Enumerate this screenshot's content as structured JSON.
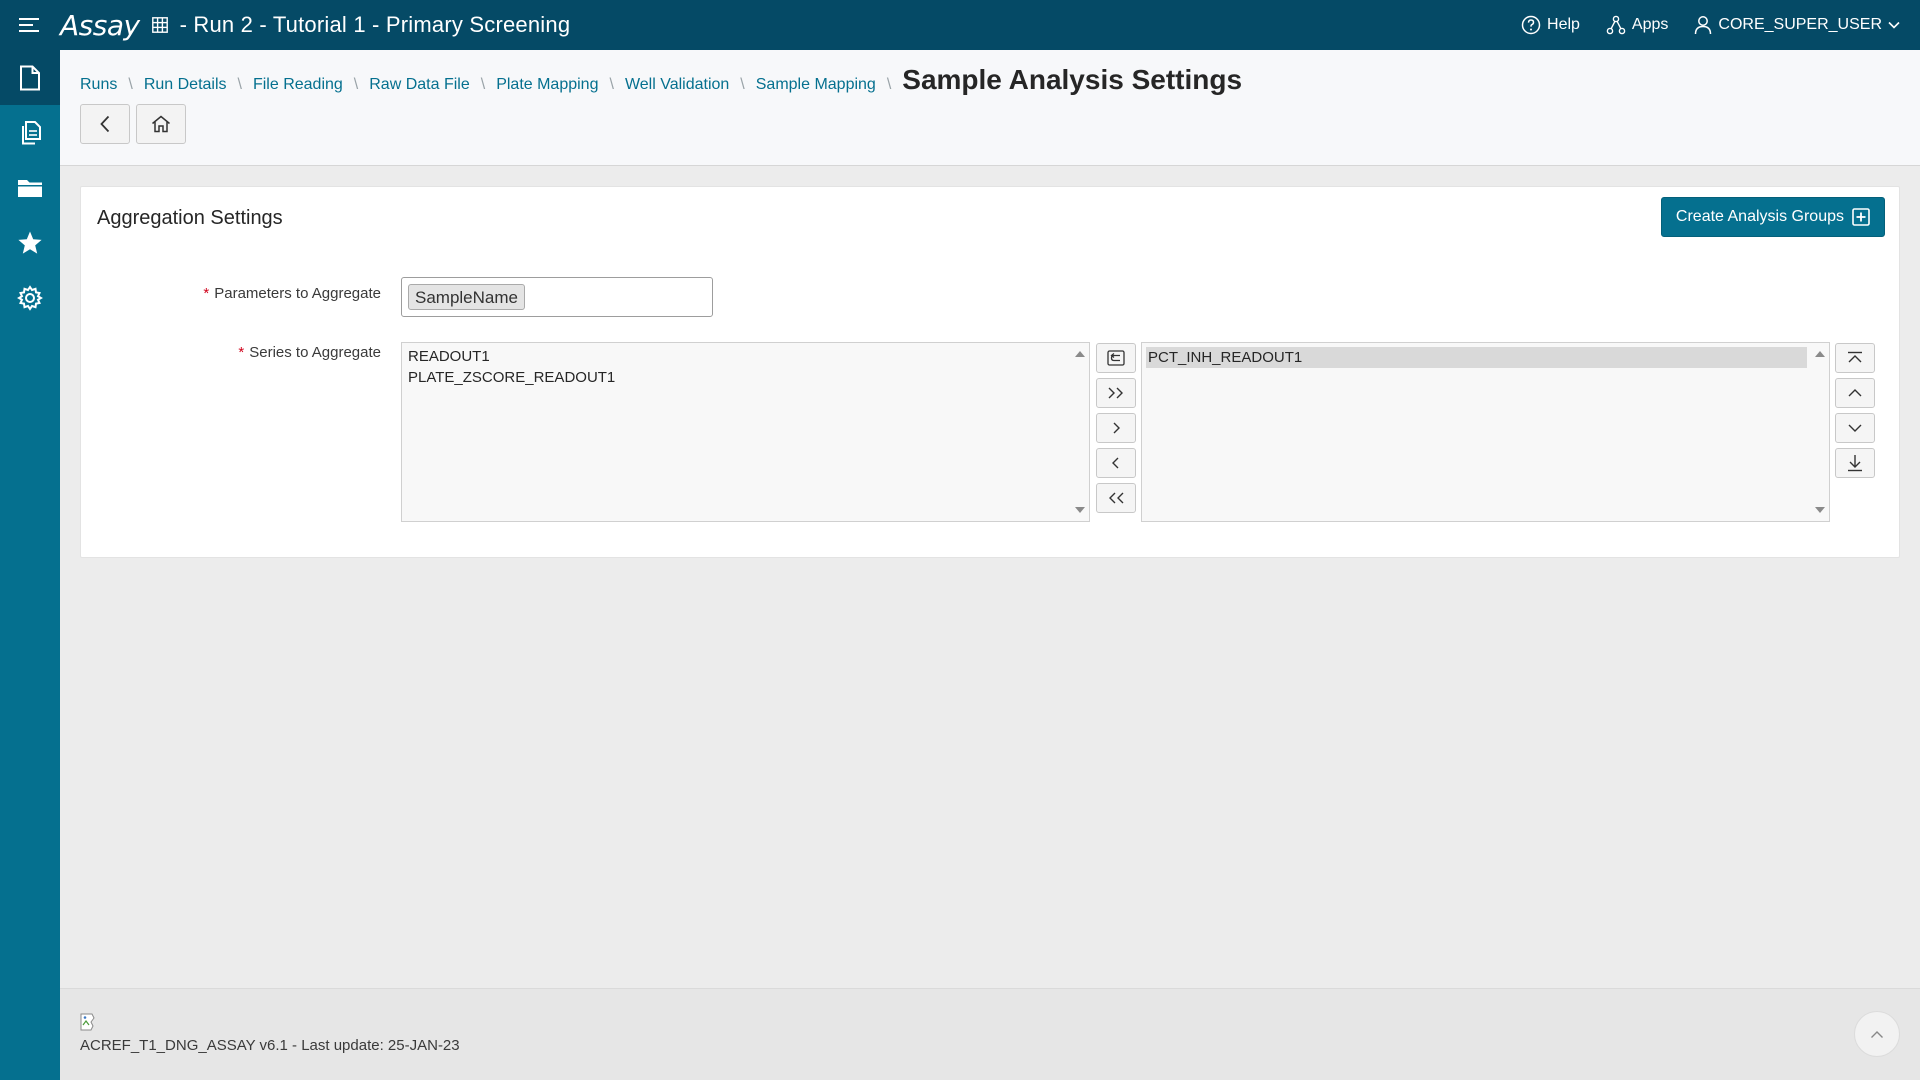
{
  "app": {
    "brand": "Assay",
    "title": "- Run 2 - Tutorial 1 - Primary Screening",
    "help_label": "Help",
    "apps_label": "Apps",
    "user_label": "CORE_SUPER_USER"
  },
  "leftnav": {
    "items": [
      {
        "icon": "document-icon",
        "active": true
      },
      {
        "icon": "copy-documents-icon",
        "active": false
      },
      {
        "icon": "folder-icon",
        "active": false
      },
      {
        "icon": "star-icon",
        "active": false
      },
      {
        "icon": "gear-icon",
        "active": false
      }
    ]
  },
  "breadcrumb": {
    "items": [
      "Runs",
      "Run Details",
      "File Reading",
      "Raw Data File",
      "Plate Mapping",
      "Well Validation",
      "Sample Mapping"
    ],
    "current": "Sample Analysis Settings"
  },
  "region": {
    "title": "Aggregation Settings",
    "create_button_label": "Create Analysis Groups"
  },
  "form": {
    "parameters_label": "Parameters to Aggregate",
    "parameters_tokens": [
      "SampleName"
    ],
    "series_label": "Series to Aggregate",
    "available_series": [
      "READOUT1",
      "PLATE_ZSCORE_READOUT1"
    ],
    "selected_series": [
      "PCT_INH_READOUT1"
    ]
  },
  "footer": {
    "text": "ACREF_T1_DNG_ASSAY v6.1 - Last update: 25-JAN-23"
  },
  "colors": {
    "topbar": "#054a66",
    "leftnav": "#05708f",
    "accent": "#05708f",
    "required": "#d0021b"
  }
}
